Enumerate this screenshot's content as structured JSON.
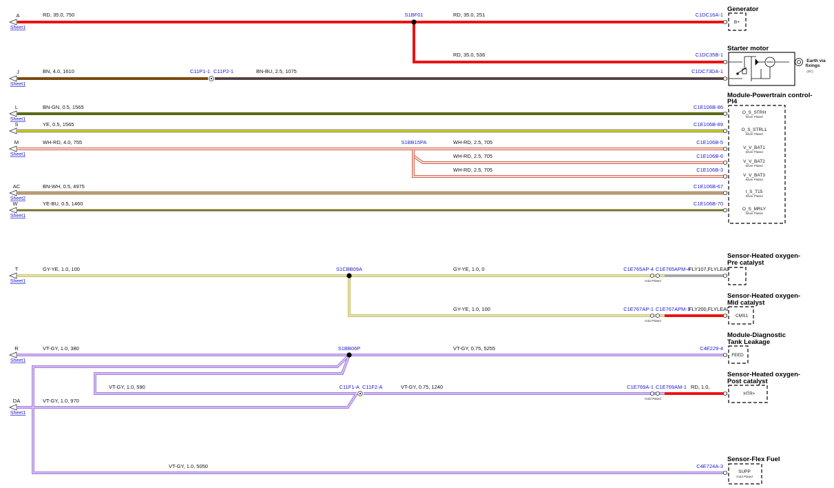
{
  "colors": {
    "RD": "#ee1111",
    "BN": "#7a4a12",
    "BN-BU": "#243a8a",
    "BN-GN": "#3d7d12",
    "YE": "#f0ec1a",
    "WH-RD": "#d46850",
    "BN-WH": "#8a5a28",
    "YE-BU": "#c9c24a",
    "GY-YE": "#c6c072",
    "VT-GY": "#a983e0",
    "GY": "#a8a8a8",
    "label": "#1a1ad0"
  },
  "ports": {
    "A": {
      "id": "A",
      "sheet": "Sheet1"
    },
    "J": {
      "id": "J",
      "sheet": "Sheet1"
    },
    "L": {
      "id": "L",
      "sheet": "Sheet1"
    },
    "S": {
      "id": "S",
      "sheet": ""
    },
    "M": {
      "id": "M",
      "sheet": "Sheet1"
    },
    "AC": {
      "id": "AC",
      "sheet": "Sheet2"
    },
    "W": {
      "id": "W",
      "sheet": "Sheet1"
    },
    "T": {
      "id": "T",
      "sheet": "Sheet1"
    },
    "R": {
      "id": "R",
      "sheet": "Sheet1"
    },
    "DA": {
      "id": "DA",
      "sheet": "Sheet1"
    }
  },
  "wires": {
    "a1": "RD, 35.0, 750",
    "a2": "RD, 35.0, 251",
    "a3": "RD, 35.0, 536",
    "j1": "BN, 4.0, 1610",
    "j2": "BN-BU, 2.5, 1075",
    "l1": "BN-GN, 0.5, 1565",
    "s1": "YE, 0.5, 1565",
    "m1": "WH-RD, 4.0, 755",
    "m2": "WH-RD, 2.5, 705",
    "m3": "WH-RD, 2.5, 705",
    "m4": "WH-RD, 2.5, 705",
    "ac1": "BN-WH, 0.5, 4975",
    "w1": "YE-BU, 0.5, 1460",
    "t1": "GY-YE, 1.0, 100",
    "t2": "GY-YE, 1.0, 0",
    "t3": "GY-YE, 1.0, 100",
    "r1": "VT-GY, 1.0, 380",
    "r2": "VT-GY, 0.75, 5255",
    "r3": "VT-GY, 1.0, 590",
    "r4": "VT-GY, 0.75, 1240",
    "r5": "RD, 1.0,",
    "da1": "VT-GY, 1.0, 970",
    "f1": "VT-GY, 1.0, 5050"
  },
  "splices": {
    "s1bf01": "S1BF01",
    "s1bb15pa": "S1BB15PA",
    "s1cbb09a": "S1CBB09A",
    "s1bb06p": "S1BB06P"
  },
  "connectors": {
    "c11p1": "C11P1-1",
    "c11p2": "C11P2-1",
    "c11f1": "C11F1-A",
    "c11f2": "C11F2-A",
    "c1dc16a": "C1DC16A-1",
    "c1dc35b": "C1DC35B-1",
    "c1dc73da": "C1DC73DA-1",
    "e86": "C1E106B-86",
    "e89": "C1E106B-89",
    "e5": "C1E106B-5",
    "e6": "C1E106B-6",
    "e3": "C1E106B-3",
    "e67": "C1E106B-67",
    "e70": "C1E106B-70",
    "c765ap": "C1E765AP-4",
    "c765apm": "C1E765APM-4",
    "flylead1": "FLY107,FLYLEAD",
    "c767ap": "C1E767AP-1",
    "c767apm": "C1E767APM-1",
    "flylead2": "FLY200,FLYLEAD",
    "c4e229": "C4E229-4",
    "c769a": "C1E769A-1",
    "c769am": "C1E769AM-1",
    "c4e724a": "C4E724A-3"
  },
  "components": {
    "generator": {
      "title": "Generator",
      "pin": "B+"
    },
    "starter": {
      "title": "Starter motor",
      "earth1": "Earth via",
      "earth2": "fixings",
      "earth3": "(DC)"
    },
    "pcm": {
      "title1": "Module-Powertrain control-",
      "title2": "PI4",
      "pins": [
        {
          "name": "O_S_STRH",
          "plating": "Silver Plated"
        },
        {
          "name": "O_S_STRL1",
          "plating": "Silver Plated"
        },
        {
          "name": "V_V_BAT1",
          "plating": "Silver Plated"
        },
        {
          "name": "V_V_BAT2",
          "plating": "Silver Plated"
        },
        {
          "name": "V_V_BAT3",
          "plating": "Silver Plated"
        },
        {
          "name": "I_S_T15",
          "plating": "Silver Plated"
        },
        {
          "name": "O_S_MRLY",
          "plating": "Silver Plated"
        }
      ]
    },
    "ho2s_pre": {
      "title1": "Sensor-Heated oxygen-",
      "title2": "Pre catalyst"
    },
    "ho2s_mid": {
      "title1": "Sensor-Heated oxygen-",
      "title2": "Mid catalyst",
      "pin": "CMS1"
    },
    "dtl": {
      "title1": "Module-Diagnostic",
      "title2": "Tank Leakage",
      "pin": "FEED"
    },
    "ho2s_post": {
      "title1": "Sensor-Heated oxygen-",
      "title2": "Post catalyst",
      "pin": "HTR+"
    },
    "flexfuel": {
      "title": "Sensor-Flex Fuel",
      "pin": "SUPP",
      "plating": "Gold Plated"
    }
  },
  "plating": {
    "gold": "Gold Plated"
  }
}
